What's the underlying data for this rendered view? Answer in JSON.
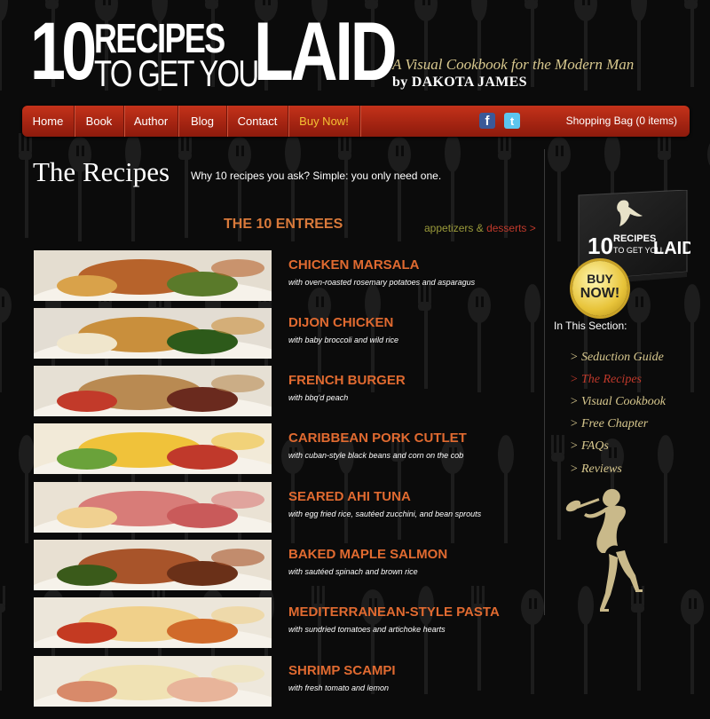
{
  "header": {
    "logo": {
      "num": "10",
      "line1": "RECIPES",
      "line2": "TO GET YOU",
      "word": "LAID"
    },
    "tagline": "A Visual Cookbook for the Modern Man",
    "byline": "by DAKOTA JAMES"
  },
  "nav": {
    "items": [
      "Home",
      "Book",
      "Author",
      "Blog",
      "Contact",
      "Buy Now!"
    ],
    "social": {
      "facebook": "f",
      "twitter": "t"
    },
    "bag": "Shopping Bag (0 items)"
  },
  "page": {
    "title": "The Recipes",
    "subtitle": "Why 10 recipes you ask? Simple: you only need one."
  },
  "entrees": {
    "heading": "THE 10 ENTREES",
    "links": {
      "appetizers": "appetizers",
      "amp": "&",
      "desserts": "desserts >"
    },
    "items": [
      {
        "name": "CHICKEN MARSALA",
        "desc": "with oven-roasted rosemary potatoes and asparagus"
      },
      {
        "name": "DIJON CHICKEN",
        "desc": "with baby broccoli and wild rice"
      },
      {
        "name": "FRENCH BURGER",
        "desc": "with bbq'd peach"
      },
      {
        "name": "CARIBBEAN PORK CUTLET",
        "desc": "with cuban-style black beans and corn on the cob"
      },
      {
        "name": "SEARED AHI TUNA",
        "desc": "with egg fried rice, sautéed zucchini, and bean sprouts"
      },
      {
        "name": "BAKED MAPLE SALMON",
        "desc": "with sautéed spinach and brown rice"
      },
      {
        "name": "MEDITERRANEAN-STYLE PASTA",
        "desc": "with sundried tomatoes and artichoke hearts"
      },
      {
        "name": "SHRIMP SCAMPI",
        "desc": "with fresh tomato and lemon"
      }
    ]
  },
  "sidebar": {
    "book": {
      "num": "10",
      "title_a": "RECIPES",
      "title_b": "TO GET YOU",
      "title_c": "LAID"
    },
    "buy_badge": {
      "line1": "BUY",
      "line2": "NOW!"
    },
    "section_label": "In This Section:",
    "links": [
      {
        "label": "> Seduction Guide",
        "active": false
      },
      {
        "label": "> The Recipes",
        "active": true
      },
      {
        "label": "> Visual Cookbook",
        "active": false
      },
      {
        "label": "> Free Chapter",
        "active": false
      },
      {
        "label": "> FAQs",
        "active": false
      },
      {
        "label": "> Reviews",
        "active": false
      }
    ]
  },
  "colors": {
    "background": "#0b0b0b",
    "nav_red": "#b5281a",
    "recipe_orange": "#e06a30",
    "gold_text": "#d8c88e",
    "active_red": "#c0392b"
  }
}
